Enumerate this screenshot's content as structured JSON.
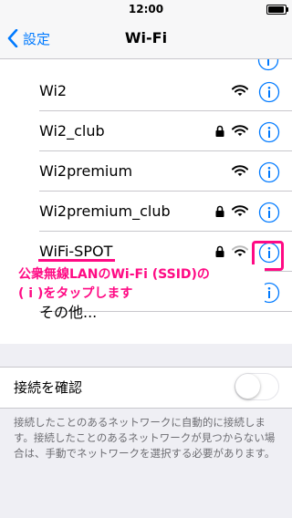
{
  "status_bar": {
    "time": "12:00"
  },
  "nav": {
    "back_label": "設定",
    "title": "Wi-Fi"
  },
  "networks": [
    {
      "name": "Wi2",
      "locked": false
    },
    {
      "name": "Wi2_club",
      "locked": true
    },
    {
      "name": "Wi2premium",
      "locked": false
    },
    {
      "name": "Wi2premium_club",
      "locked": true
    },
    {
      "name": "WiFi-SPOT",
      "locked": true
    },
    {
      "name": "",
      "locked": true
    }
  ],
  "other_label": "その他...",
  "annotation": {
    "line1": "公衆無線LANのWi-Fi (SSID)の",
    "line2": "( i )をタップします"
  },
  "ask_to_join": {
    "label": "接続を確認",
    "enabled": false
  },
  "footer": {
    "text": "接続したことのあるネットワークに自動的に接続します。接続したことのあるネットワークが見つからない場合は、手動でネットワークを選択する必要があります。"
  },
  "colors": {
    "accent": "#007aff",
    "highlight": "#ff0a84"
  },
  "icons": {
    "back": "chevron-left-icon",
    "lock": "lock-icon",
    "wifi": "wifi-icon",
    "info": "info-icon"
  }
}
